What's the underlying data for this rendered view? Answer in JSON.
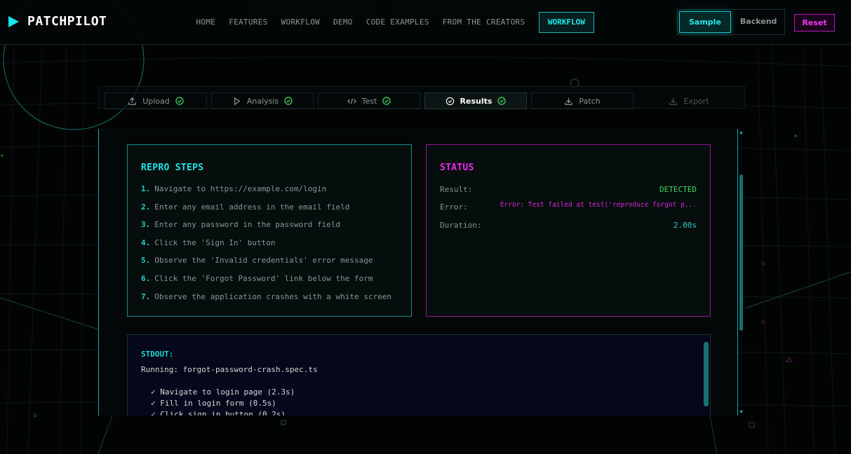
{
  "brand": {
    "name": "PATCHPILOT"
  },
  "nav": {
    "links": [
      "HOME",
      "FEATURES",
      "WORKFLOW",
      "DEMO",
      "CODE EXAMPLES",
      "FROM THE CREATORS"
    ],
    "active": "WORKFLOW"
  },
  "mode": {
    "sample": "Sample",
    "backend": "Backend",
    "selected": "Sample"
  },
  "reset_label": "Reset",
  "steps": [
    {
      "label": "Upload",
      "done": true,
      "icon": "upload-icon"
    },
    {
      "label": "Analysis",
      "done": true,
      "icon": "play-icon"
    },
    {
      "label": "Test",
      "done": true,
      "icon": "code-icon"
    },
    {
      "label": "Results",
      "done": true,
      "icon": "check-circle-icon",
      "active": true
    },
    {
      "label": "Patch",
      "done": false,
      "icon": "download-icon"
    },
    {
      "label": "Export",
      "done": false,
      "icon": "download-icon",
      "disabled": true
    }
  ],
  "repro": {
    "title": "REPRO STEPS",
    "items": [
      "Navigate to https://example.com/login",
      "Enter any email address in the email field",
      "Enter any password in the password field",
      "Click the 'Sign In' button",
      "Observe the 'Invalid credentials' error message",
      "Click the 'Forgot Password' link below the form",
      "Observe the application crashes with a white screen"
    ]
  },
  "status": {
    "title": "STATUS",
    "result_label": "Result:",
    "result_value": "DETECTED",
    "error_label": "Error:",
    "error_value": "Error: Test failed at test('reproduce forgot p...",
    "duration_label": "Duration:",
    "duration_value": "2.00s"
  },
  "stdout": {
    "label": "STDOUT:",
    "running": "Running: forgot-password-crash.spec.ts",
    "lines": [
      "✓ Navigate to login page (2.3s)",
      "✓ Fill in login form (0.5s)",
      "✓ Click sign in button (0.2s)"
    ]
  },
  "colors": {
    "accent_cyan": "#12e6e6",
    "accent_magenta": "#ee2aee",
    "success_green": "#3edc5a",
    "background": "#020404"
  }
}
